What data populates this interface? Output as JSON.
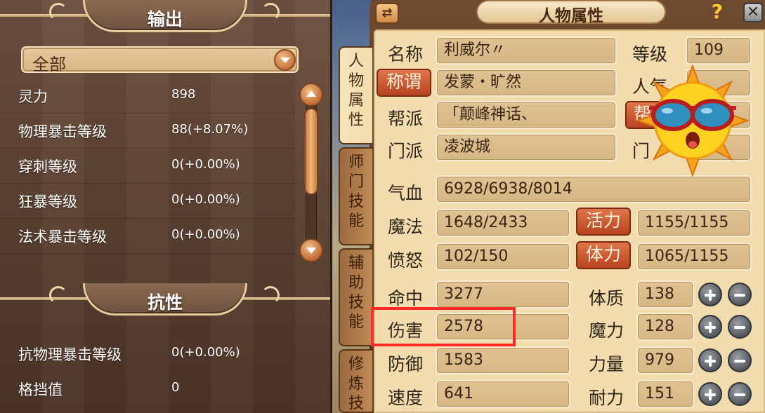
{
  "left_panel": {
    "output_header": "输出",
    "filter_selected": "全部",
    "output_stats": [
      {
        "name": "灵力",
        "value": "898"
      },
      {
        "name": "物理暴击等级",
        "value": "88(+8.07%)"
      },
      {
        "name": "穿刺等级",
        "value": "0(+0.00%)"
      },
      {
        "name": "狂暴等级",
        "value": "0(+0.00%)"
      },
      {
        "name": "法术暴击等级",
        "value": "0(+0.00%)"
      }
    ],
    "resist_header": "抗性",
    "resist_stats": [
      {
        "name": "抗物理暴击等级",
        "value": "0(+0.00%)"
      },
      {
        "name": "格挡值",
        "value": "0"
      }
    ]
  },
  "right_panel": {
    "title": "人物属性",
    "swap_icon": "⇄",
    "help_icon": "?",
    "close_icon": "✕",
    "tabs": [
      "人物属性",
      "师门技能",
      "辅助技能",
      "修炼技"
    ],
    "name_label": "名称",
    "name_value": "利威尔〃",
    "level_label": "等级",
    "level_value": "109",
    "title_button": "称谓",
    "title_value": "发蒙・旷然",
    "popularity_label_visible": "人气",
    "gang_label": "帮派",
    "gang_value": "「颠峰神话、",
    "gang_button_visible": "帮",
    "school_label": "门派",
    "school_value": "凌波城",
    "school_extra_visible": "门",
    "hp_label": "气血",
    "hp_value": "6928/6938/8014",
    "mp_label": "魔法",
    "mp_value": "1648/2433",
    "vitality_button": "活力",
    "vitality_value": "1155/1155",
    "rage_label": "愤怒",
    "rage_value": "102/150",
    "stamina_button": "体力",
    "stamina_value": "1065/1155",
    "combat_stats": [
      {
        "label": "命中",
        "value": "3277"
      },
      {
        "label": "伤害",
        "value": "2578"
      },
      {
        "label": "防御",
        "value": "1583"
      },
      {
        "label": "速度",
        "value": "641"
      }
    ],
    "attributes": [
      {
        "label": "体质",
        "value": "138"
      },
      {
        "label": "魔力",
        "value": "128"
      },
      {
        "label": "力量",
        "value": "979"
      },
      {
        "label": "耐力",
        "value": "151"
      }
    ]
  },
  "colors": {
    "highlight": "#ff2a2a",
    "accent_button": "#c9542a",
    "parchment": "#f2dcae"
  },
  "sticker": {
    "icon": "sun-with-sunglasses-icon"
  }
}
